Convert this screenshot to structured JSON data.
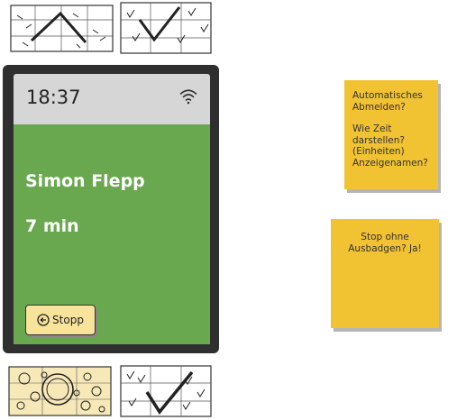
{
  "device": {
    "time": "18:37",
    "person_name": "Simon Flepp",
    "duration": "7 min",
    "stop_label": "Stopp",
    "screen_color": "#69a84f",
    "statusbar_color": "#d6d6d6",
    "button_color": "#f7e39a"
  },
  "icons": {
    "status": "wifi-icon",
    "stop_button": "arrow-left-circle-icon"
  },
  "notes": [
    {
      "lines_a": [
        "Automatisches",
        "Abmelden?"
      ],
      "lines_b": [
        "Wie Zeit",
        "darstellen?",
        "(Einheiten)",
        "Anzeigenamen?"
      ]
    },
    {
      "lines": [
        "Stop ohne",
        "Ausbadgen? Ja!"
      ]
    }
  ],
  "note_color": "#f1c232"
}
